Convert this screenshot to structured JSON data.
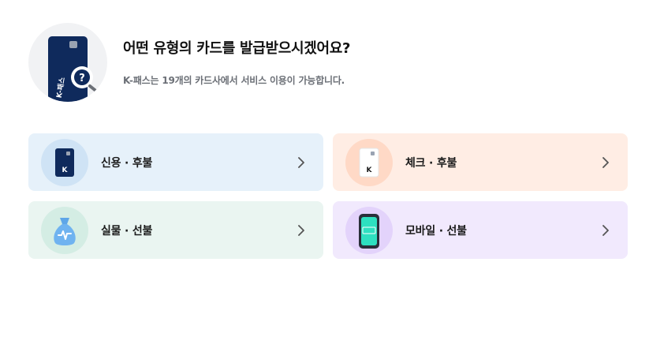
{
  "header": {
    "title": "어떤 유형의 카드를 발급받으시겠어요?",
    "subtitle": "K-패스는 19개의 카드사에서 서비스 이용이 가능합니다.",
    "icon": "card-question-icon"
  },
  "options": [
    {
      "label": "신용 · 후불",
      "icon": "credit-card-icon",
      "bg": "#e6f1fa",
      "icon_bg": "#cfe3f5"
    },
    {
      "label": "체크 · 후불",
      "icon": "check-card-icon",
      "bg": "#ffede4",
      "icon_bg": "#ffd9c6"
    },
    {
      "label": "실물 · 선불",
      "icon": "money-bag-icon",
      "bg": "#eaf5f1",
      "icon_bg": "#d4ede4"
    },
    {
      "label": "모바일 · 선불",
      "icon": "mobile-phone-icon",
      "bg": "#f1e9fd",
      "icon_bg": "#e3d3fb"
    }
  ],
  "colors": {
    "card_navy": "#0f2a5c",
    "chevron": "#555555"
  }
}
